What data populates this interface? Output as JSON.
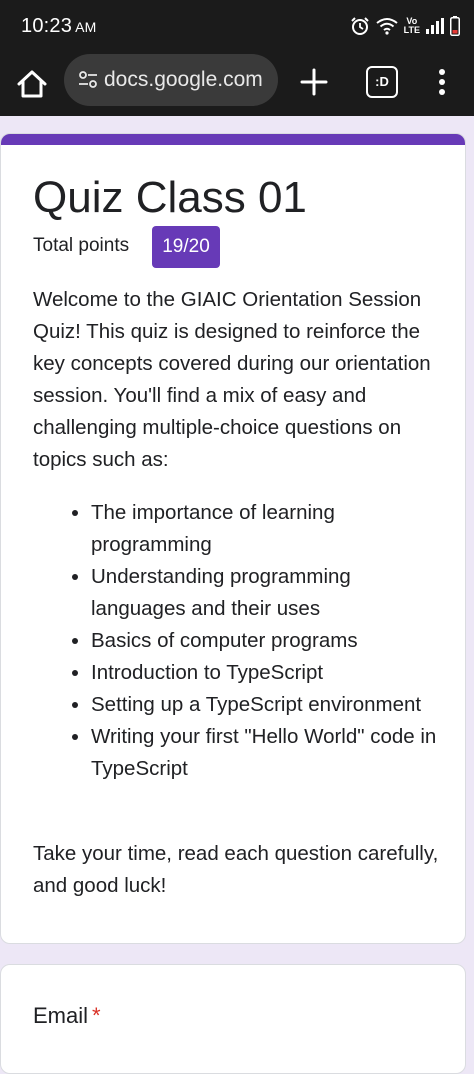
{
  "status_bar": {
    "time": "10:23",
    "ampm": "AM",
    "icons": [
      "alarm-icon",
      "wifi-icon",
      "volte-icon",
      "signal-icon",
      "battery-icon"
    ],
    "volte_label_top": "Vo",
    "volte_label_bottom": "LTE"
  },
  "browser": {
    "url": "docs.google.com",
    "tabs_label": ":D",
    "icons": [
      "home-icon",
      "site-settings-icon",
      "new-tab-icon",
      "tab-switcher-icon",
      "more-menu-icon"
    ]
  },
  "form": {
    "title": "Quiz Class 01",
    "points_label": "Total points",
    "points_value": "19/20",
    "description": "Welcome to the GIAIC Orientation Session Quiz! This quiz is designed to reinforce the key concepts covered during our orientation session. You'll find a mix of easy and challenging multiple-choice questions on topics such as:",
    "topics": [
      "The importance of learning programming",
      "Understanding programming languages and their uses",
      "Basics of computer programs",
      "Introduction to TypeScript",
      "Setting up a TypeScript environment",
      "Writing your first \"Hello World\" code in TypeScript"
    ],
    "closing": "Take your time, read each question carefully, and good luck!",
    "email_label": "Email",
    "required_mark": "*"
  },
  "colors": {
    "accent": "#673ab7",
    "page_background": "#ede7f6",
    "toolbar": "#1b1b1b",
    "required": "#d93025"
  }
}
